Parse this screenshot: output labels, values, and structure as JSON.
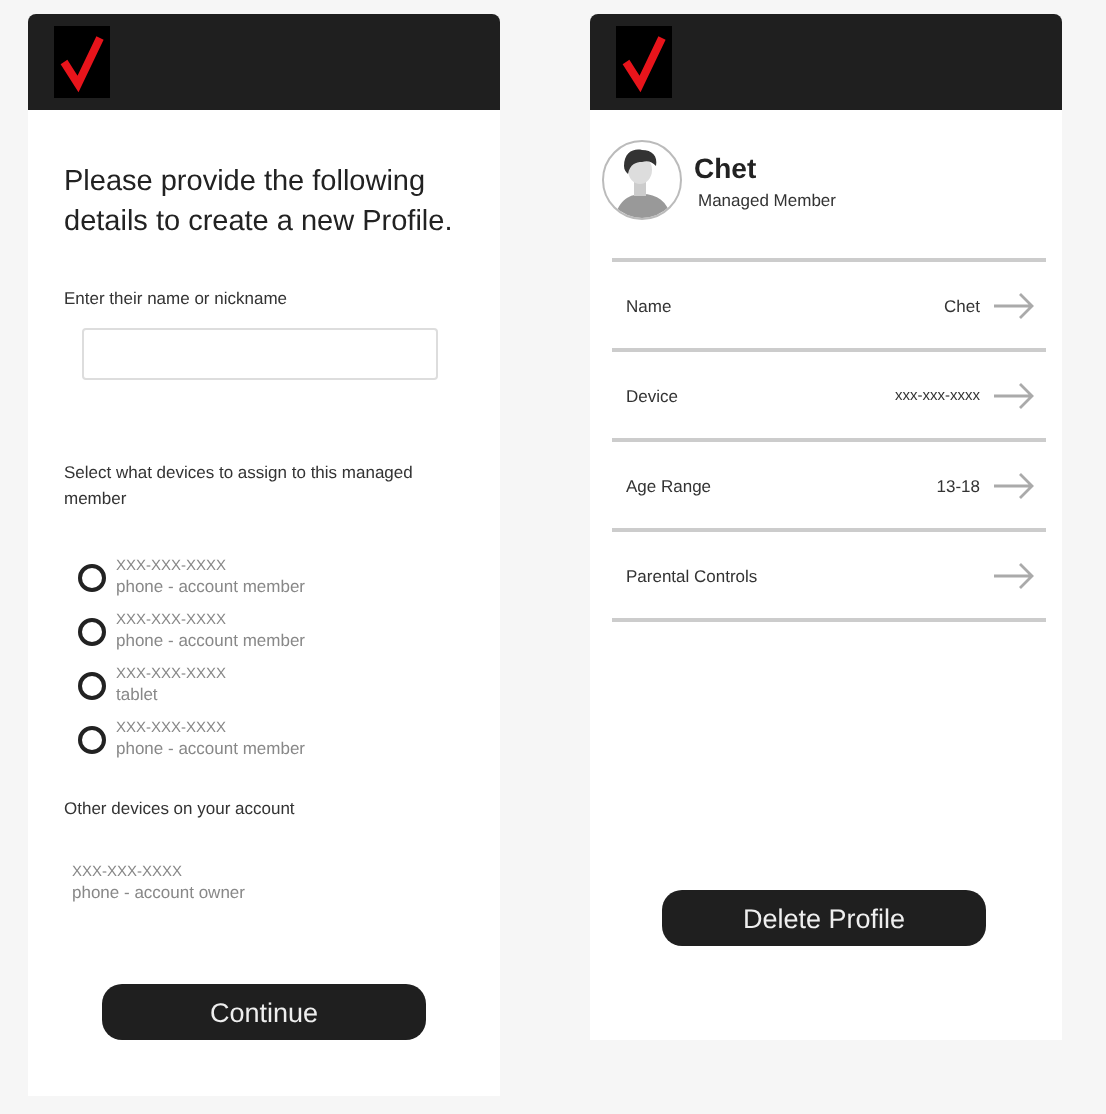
{
  "create_screen": {
    "heading": "Please provide the following details to create a new Profile.",
    "name_label": "Enter their name or nickname",
    "devices_label": "Select what devices to assign to this managed member",
    "devices": [
      {
        "number": "XXX-XXX-XXXX",
        "type": "phone - account member",
        "selected": false
      },
      {
        "number": "XXX-XXX-XXXX",
        "type": "phone - account member",
        "selected": false
      },
      {
        "number": "XXX-XXX-XXXX",
        "type": "tablet",
        "selected": false
      },
      {
        "number": "XXX-XXX-XXXX",
        "type": "phone - account member",
        "selected": false
      }
    ],
    "other_label": "Other devices on your account",
    "other_devices": [
      {
        "number": "XXX-XXX-XXXX",
        "type": "phone - account owner"
      }
    ],
    "continue_button": "Continue"
  },
  "profile_screen": {
    "name": "Chet",
    "role": "Managed Member",
    "rows": [
      {
        "label": "Name",
        "value": "Chet"
      },
      {
        "label": "Device",
        "value": "xxx-xxx-xxxx"
      },
      {
        "label": "Age Range",
        "value": "13-18"
      },
      {
        "label": "Parental Controls"
      }
    ],
    "delete_button": "Delete Profile"
  }
}
